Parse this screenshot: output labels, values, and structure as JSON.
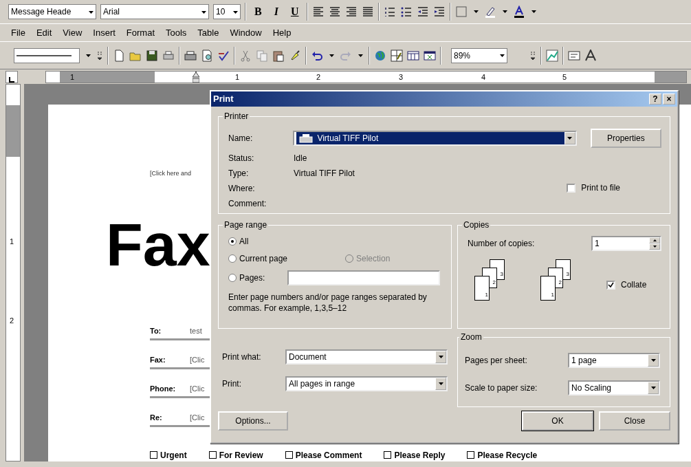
{
  "formatting_toolbar": {
    "style": "Message Heade",
    "font": "Arial",
    "size": "10",
    "bold": "B",
    "italic": "I",
    "underline": "U"
  },
  "menu_bar": [
    {
      "label": "File"
    },
    {
      "label": "Edit"
    },
    {
      "label": "View"
    },
    {
      "label": "Insert"
    },
    {
      "label": "Format"
    },
    {
      "label": "Tools"
    },
    {
      "label": "Table"
    },
    {
      "label": "Window"
    },
    {
      "label": "Help"
    }
  ],
  "standard_toolbar": {
    "zoom": "89%"
  },
  "ruler": {
    "labels": [
      "1",
      "1",
      "2",
      "3",
      "4",
      "5"
    ]
  },
  "vertical_ruler": {
    "labels": [
      "1",
      "2"
    ]
  },
  "document": {
    "header_placeholder": "[Click here and",
    "title": "Fax",
    "fields": [
      {
        "label": "To:",
        "value": "test"
      },
      {
        "label": "Fax:",
        "value": "[Clic"
      },
      {
        "label": "Phone:",
        "value": "[Clic"
      },
      {
        "label": "Re:",
        "value": "[Clic"
      }
    ],
    "checkboxes": [
      {
        "label": "Urgent",
        "checked": false
      },
      {
        "label": "For Review",
        "checked": false
      },
      {
        "label": "Please Comment",
        "checked": false
      },
      {
        "label": "Please Reply",
        "checked": false
      },
      {
        "label": "Please Recycle",
        "checked": false
      }
    ]
  },
  "print_dialog": {
    "title": "Print",
    "title_buttons": [
      "?",
      "×"
    ],
    "printer": {
      "legend": "Printer",
      "name_label": "Name:",
      "name": "Virtual TIFF Pilot",
      "properties": "Properties",
      "info": [
        {
          "label": "Status:",
          "value": "Idle"
        },
        {
          "label": "Type:",
          "value": "Virtual TIFF Pilot"
        },
        {
          "label": "Where:"
        },
        {
          "label": "Comment:"
        }
      ],
      "print_to_file": {
        "label": "Print to file",
        "checked": false
      }
    },
    "page_range": {
      "legend": "Page range",
      "options": [
        {
          "label": "All",
          "selected": true,
          "disabled": false
        },
        {
          "label": "Current page",
          "selected": false,
          "disabled": false
        },
        {
          "label": "Selection",
          "selected": false,
          "disabled": true
        },
        {
          "label": "Pages:",
          "selected": false,
          "disabled": false
        }
      ],
      "hint": "Enter page numbers and/or page ranges separated by commas.  For example, 1,3,5–12"
    },
    "copies": {
      "legend": "Copies",
      "label": "Number of copies:",
      "value": "1",
      "sets": [
        [
          "3",
          "2",
          "1"
        ],
        [
          "3",
          "2",
          "1"
        ]
      ],
      "collate": {
        "label": "Collate",
        "checked": true
      }
    },
    "print_what": {
      "label": "Print what:",
      "value": "Document"
    },
    "print": {
      "label": "Print:",
      "value": "All pages in range"
    },
    "zoom": {
      "legend": "Zoom",
      "pages_label": "Pages per sheet:",
      "pages": "1 page",
      "scale_label": "Scale to paper size:",
      "scale": "No Scaling"
    },
    "buttons": {
      "options": "Options...",
      "ok": "OK",
      "close": "Close"
    }
  }
}
